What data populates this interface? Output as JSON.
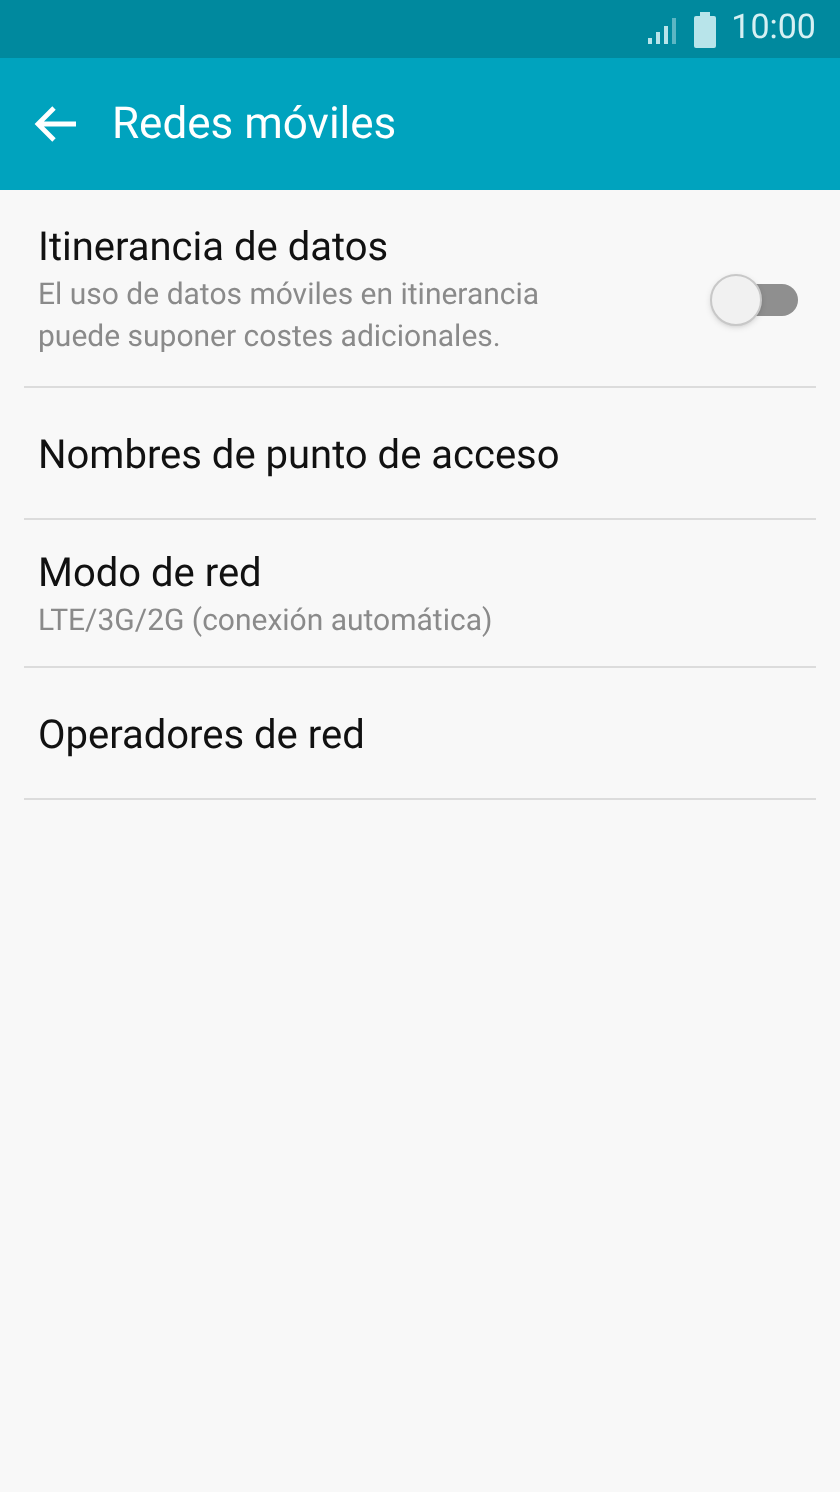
{
  "status_bar": {
    "time": "10:00"
  },
  "app_bar": {
    "title": "Redes móviles"
  },
  "settings": [
    {
      "kind": "toggle",
      "title": "Itinerancia de datos",
      "subtitle": "El uso de datos móviles en itinerancia puede suponer costes adicionales.",
      "on": false
    },
    {
      "kind": "plain",
      "title": "Nombres de punto de acceso"
    },
    {
      "kind": "plain",
      "title": "Modo de red",
      "subtitle": "LTE/3G/2G (conexión automática)"
    },
    {
      "kind": "plain",
      "title": "Operadores de red"
    }
  ]
}
